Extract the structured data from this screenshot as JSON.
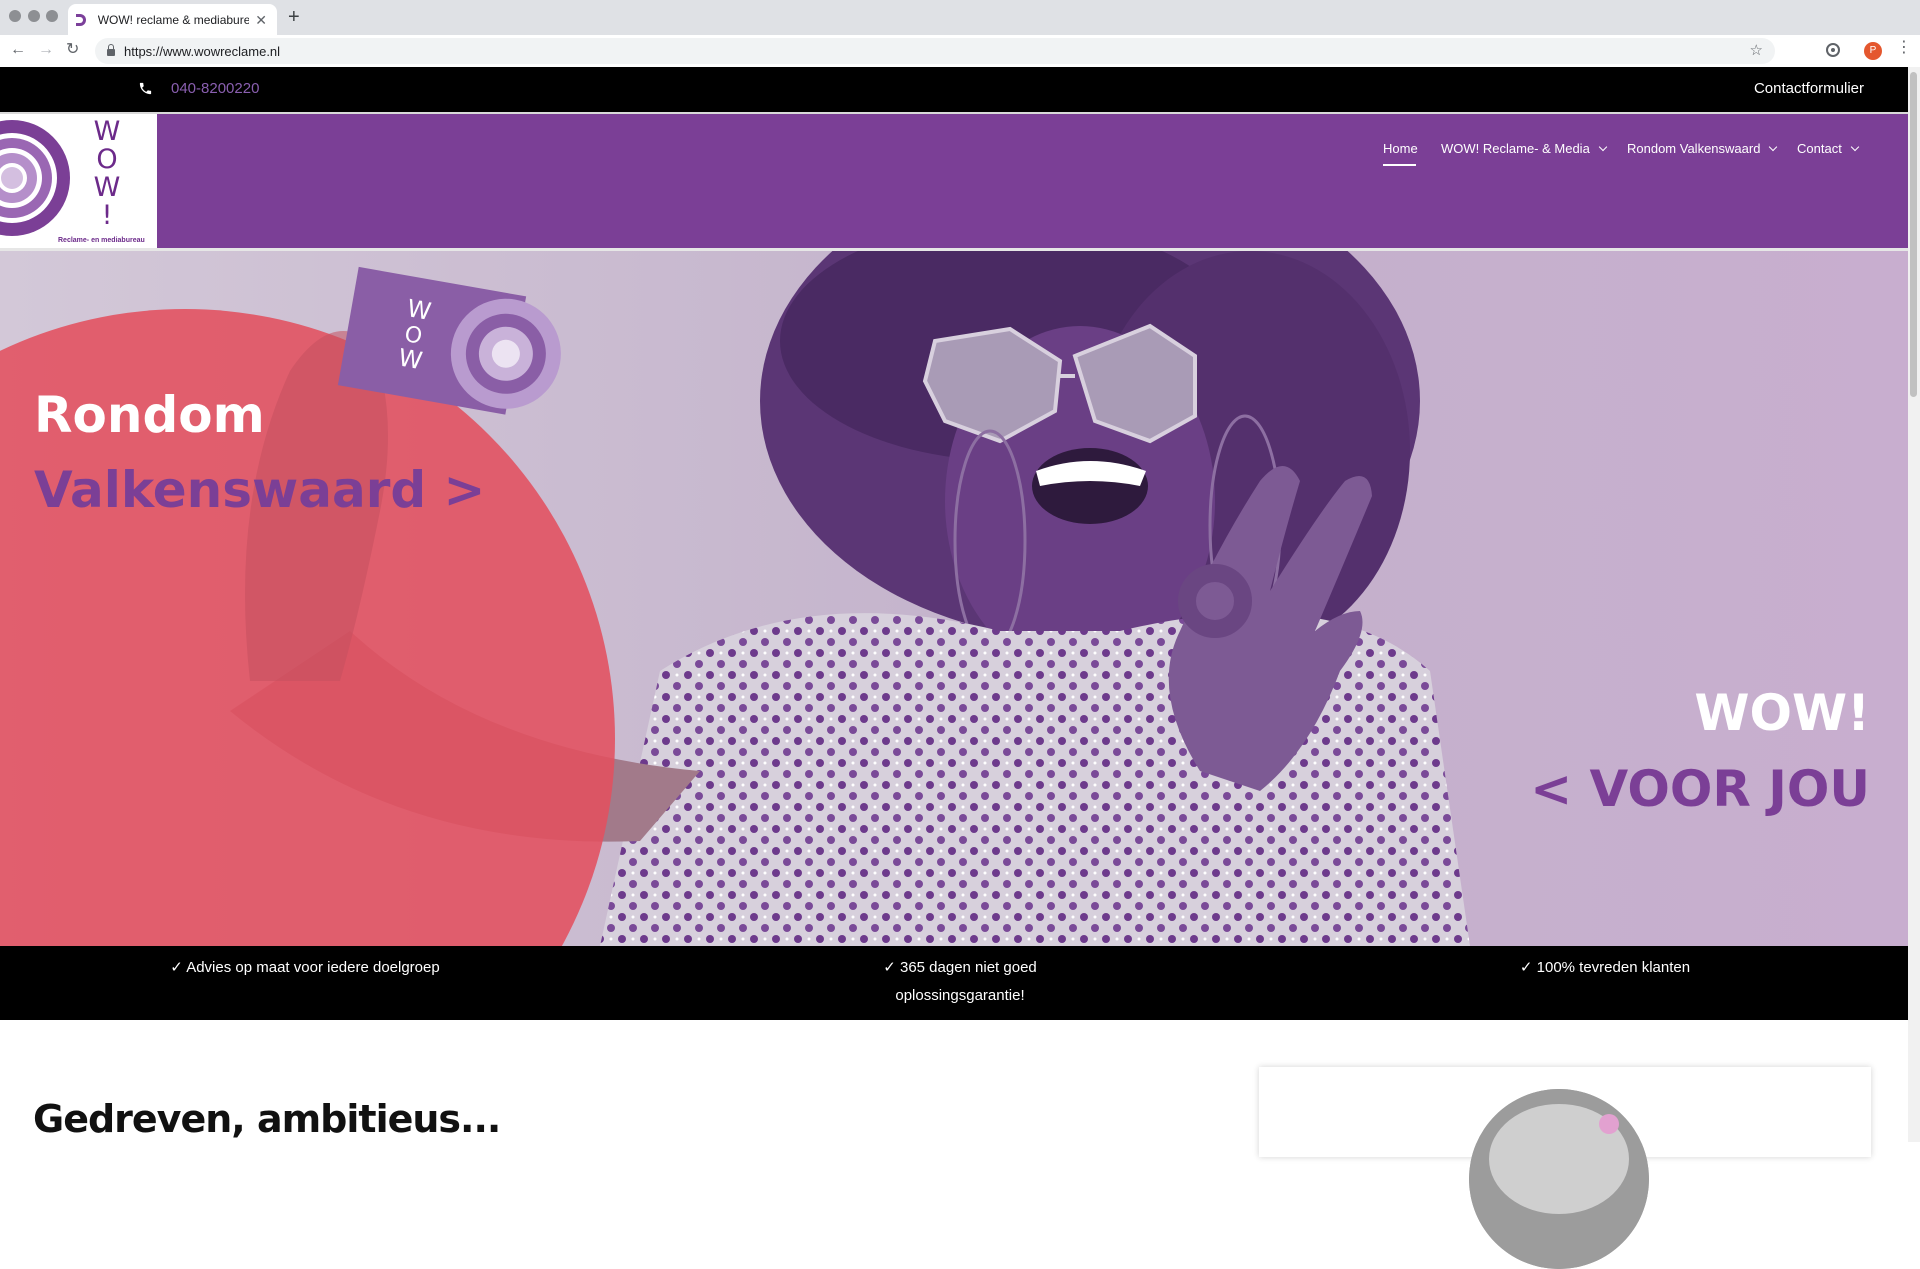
{
  "browser": {
    "tab_title": "WOW! reclame & mediabureau",
    "url": "https://www.wowreclame.nl",
    "profile_initial": "P"
  },
  "topbar": {
    "phone": "040-8200220",
    "contact_form": "Contactformulier"
  },
  "logo": {
    "letters": [
      "W",
      "O",
      "W",
      "!"
    ],
    "tagline": "Reclame- en mediabureau"
  },
  "nav": {
    "items": [
      {
        "label": "Home",
        "active": true
      },
      {
        "label": "WOW! Reclame- & Media",
        "dropdown": true
      },
      {
        "label": "Rondom Valkenswaard",
        "dropdown": true
      },
      {
        "label": "Contact",
        "dropdown": true
      }
    ]
  },
  "hero": {
    "left_line1": "Rondom",
    "left_line2": "Valkenswaard >",
    "right_line1": "WOW!",
    "right_line2": "< VOOR JOU"
  },
  "features": [
    {
      "line1": "✓ Advies op maat voor iedere doelgroep",
      "line2": ""
    },
    {
      "line1": "✓ 365 dagen niet goed",
      "line2": "oplossingsgarantie!"
    },
    {
      "line1": "✓ 100% tevreden klanten",
      "line2": ""
    }
  ],
  "intro": {
    "title": "Gedreven, ambitieus..."
  },
  "colors": {
    "brand_purple": "#7b3f96",
    "accent_red": "#e2505f",
    "black": "#000000"
  }
}
